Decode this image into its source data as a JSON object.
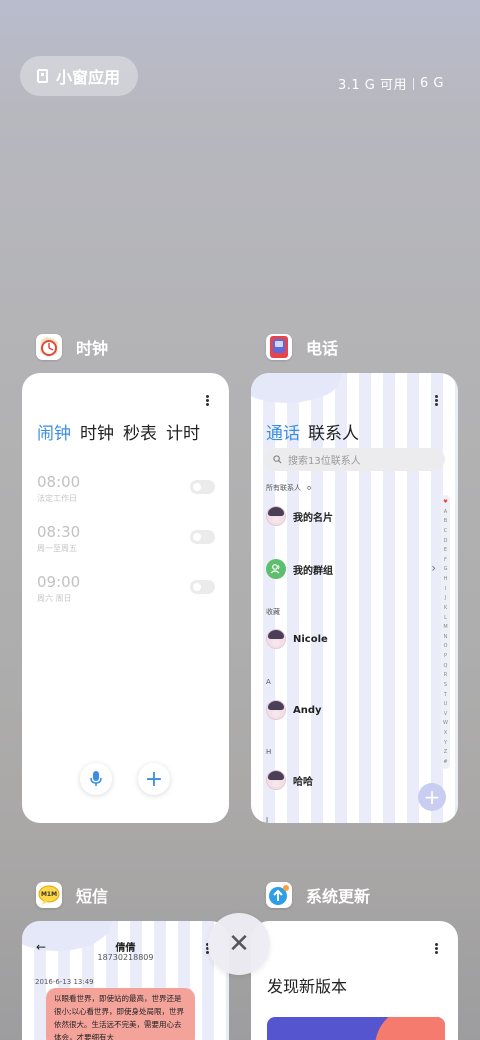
{
  "topbar": {
    "small_window_label": "小窗应用",
    "memory_available": "3.1 G 可用",
    "memory_total": "6 G"
  },
  "clock": {
    "app_name": "时钟",
    "tabs": [
      "闹钟",
      "时钟",
      "秒表",
      "计时"
    ],
    "alarms": [
      {
        "time": "08:00",
        "repeat": "法定工作日"
      },
      {
        "time": "08:30",
        "repeat": "周一至周五"
      },
      {
        "time": "09:00",
        "repeat": "周六 周日"
      }
    ],
    "add_symbol": "+"
  },
  "phone": {
    "app_name": "电话",
    "tabs": [
      "通话",
      "联系人"
    ],
    "search_placeholder": "搜索13位联系人",
    "all_contacts_label": "所有联系人",
    "sort_symbol": "≎",
    "favorites_label": "收藏",
    "section_a": "A",
    "section_h": "H",
    "section_next": "J",
    "contacts": {
      "my_card": "我的名片",
      "my_groups": "我的群组",
      "nicole": "Nicole",
      "andy": "Andy",
      "haha": "哈哈"
    },
    "chevron": "›",
    "index_letters": [
      "♥",
      "A",
      "B",
      "C",
      "D",
      "E",
      "F",
      "G",
      "H",
      "I",
      "J",
      "K",
      "L",
      "M",
      "N",
      "O",
      "P",
      "Q",
      "R",
      "S",
      "T",
      "U",
      "V",
      "W",
      "X",
      "Y",
      "Z",
      "#"
    ],
    "add_symbol": "+"
  },
  "sms": {
    "app_name": "短信",
    "contact_name": "倩倩",
    "contact_number": "18730218809",
    "back_symbol": "←",
    "date": "2016-6-13 13:49",
    "message": "以眼看世界，即使站的最高，世界还是很小;以心看世界，即使身处局限，世界依然很大。生活远不完美，需要用心去体会，才要细有大"
  },
  "update": {
    "app_name": "系统更新",
    "headline": "发现新版本"
  },
  "close_symbol": "✕",
  "colors": {
    "accent": "#3a8ee6",
    "bubble": "#f4a39b"
  }
}
